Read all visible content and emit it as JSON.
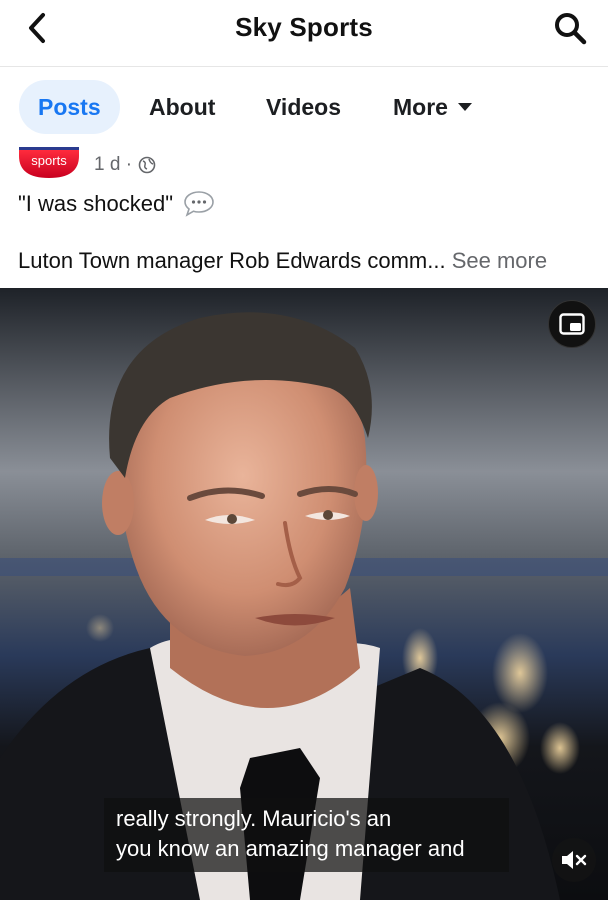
{
  "header": {
    "title": "Sky Sports",
    "back_icon": "chevron-left-icon",
    "search_icon": "search-icon"
  },
  "tabs": [
    {
      "label": "Posts",
      "active": true
    },
    {
      "label": "About",
      "active": false
    },
    {
      "label": "Videos",
      "active": false
    },
    {
      "label": "More",
      "active": false
    }
  ],
  "post": {
    "logo_text": "sports",
    "time": "1 d ·",
    "privacy_icon": "globe-icon",
    "headline": "\"I was shocked\"",
    "headline_icon": "speech-bubble-icon",
    "description": "Luton Town manager Rob Edwards comm...",
    "see_more": "See more"
  },
  "video": {
    "caption_line1": "really strongly. Mauricio's an",
    "caption_line2": "you know an amazing manager and",
    "pip_icon": "picture-in-picture-icon",
    "mute_icon": "muted-speaker-icon"
  },
  "colors": {
    "accent": "#1877f2",
    "tab_active_bg": "#e7f1fd",
    "sky_red": "#e4002b"
  }
}
